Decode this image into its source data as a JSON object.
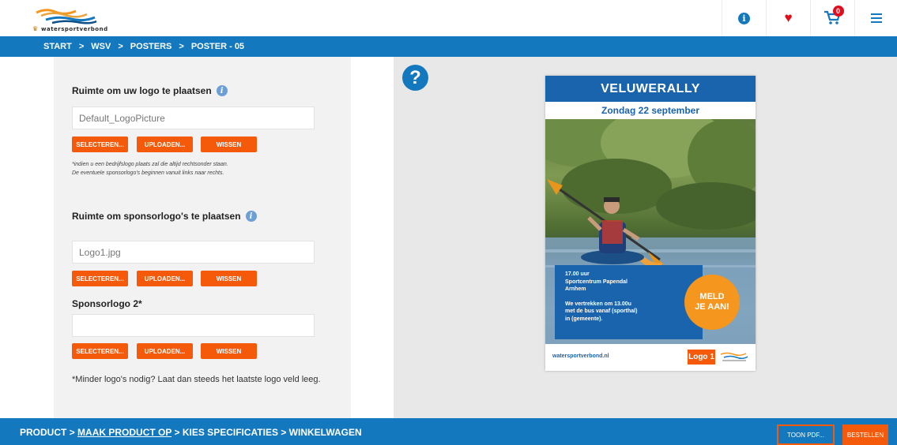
{
  "header": {
    "brand": "watersportverbond",
    "cart_count": "0"
  },
  "breadcrumb": [
    "START",
    "WSV",
    "POSTERS",
    "POSTER - 05"
  ],
  "form": {
    "logo_section_title": "Ruimte om uw logo te plaatsen",
    "logo_field_value": "Default_LogoPicture",
    "buttons": {
      "select": "SELECTEREN...",
      "upload": "UPLOADEN...",
      "clear": "WISSEN"
    },
    "logo_note_line1": "*indien u een bedrijfslogo plaats zal die altijd rechtsonder staan.",
    "logo_note_line2": "De eventuele sponsorlogo's beginnen vanuit links naar rechts.",
    "sponsor_section_title": "Ruimte om sponsorlogo's te plaatsen",
    "sponsor1_value": "Logo1.jpg",
    "sponsor2_label": "Sponsorlogo 2*",
    "sponsor2_value": "",
    "footnote": "*Minder logo's nodig? Laat dan steeds het laatste logo veld leeg."
  },
  "poster": {
    "title": "VELUWERALLY",
    "date": "Zondag 22 september",
    "time": "17.00 uur",
    "venue": "Sportcentrum Papendal",
    "city": "Arnhem",
    "depart_line1": "We vertrekken om 13.00u",
    "depart_line2": "met de bus vanaf (sporthal)",
    "depart_line3": "in (gemeente).",
    "badge_line1": "MELD",
    "badge_line2": "JE AAN!",
    "url": "watersportverbond.nl",
    "logo_label": "Logo 1"
  },
  "footer": {
    "step1": "PRODUCT",
    "step2": "MAAK PRODUCT OP",
    "step3": "KIES SPECIFICATIES",
    "step4": "WINKELWAGEN",
    "pdf_button": "TOON PDF...",
    "order_button": "BESTELLEN"
  },
  "colors": {
    "primary_blue": "#1478be",
    "accent_orange": "#f55a0a",
    "heart_red": "#e00d1c",
    "badge_orange": "#f5961e"
  },
  "icons": [
    "info-icon",
    "heart-icon",
    "cart-icon",
    "menu-icon",
    "help-icon",
    "question-icon"
  ]
}
